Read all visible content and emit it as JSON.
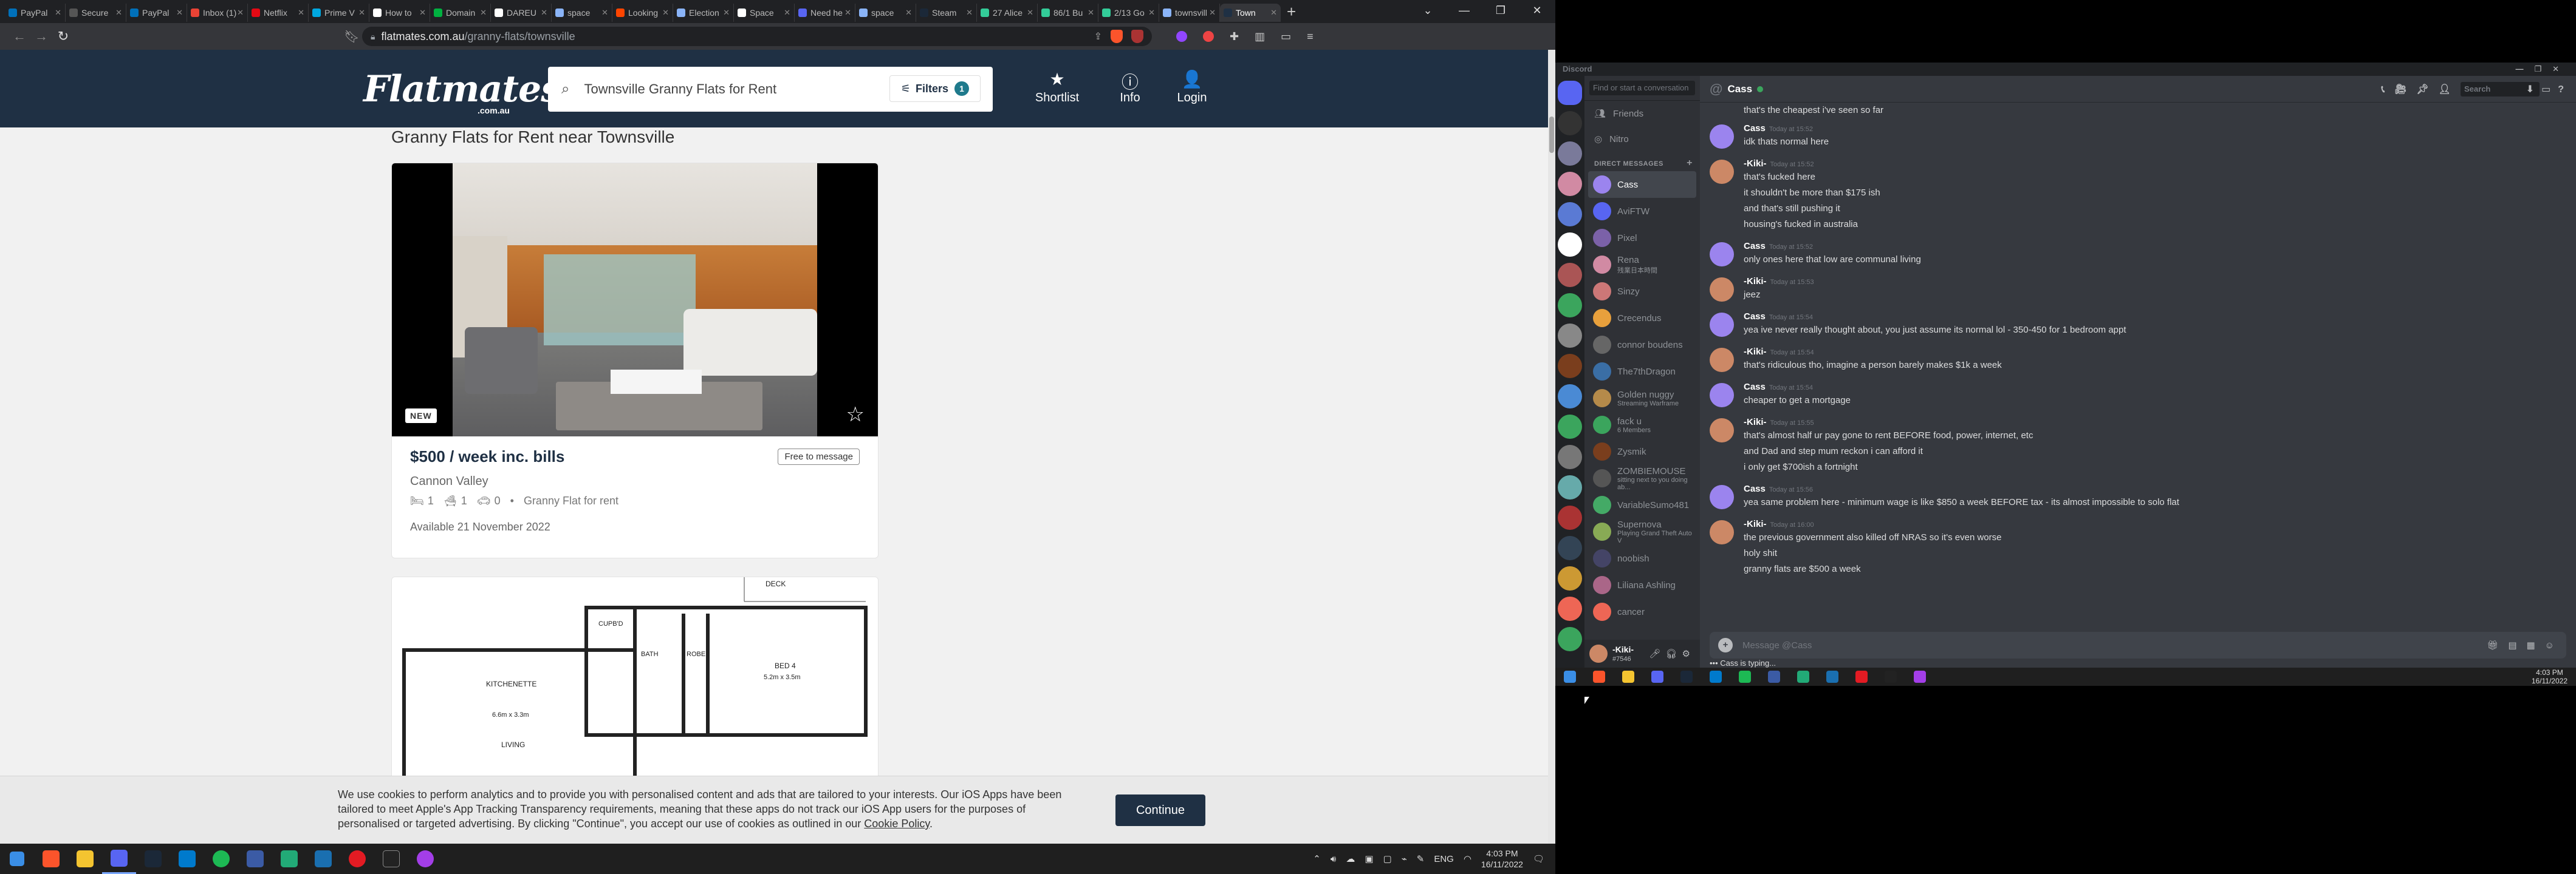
{
  "browser": {
    "tabs": [
      {
        "label": "PayPal",
        "color": "#0070ba"
      },
      {
        "label": "Secure",
        "color": "#555"
      },
      {
        "label": "PayPal",
        "color": "#0070ba"
      },
      {
        "label": "Inbox (1)",
        "color": "#ea4335"
      },
      {
        "label": "Netflix",
        "color": "#e50914"
      },
      {
        "label": "Prime V",
        "color": "#00a8e1"
      },
      {
        "label": "How to",
        "color": "#fff"
      },
      {
        "label": "Domain",
        "color": "#00b140"
      },
      {
        "label": "DAREU",
        "color": "#fff"
      },
      {
        "label": "space",
        "color": "#8ab4f8"
      },
      {
        "label": "Looking",
        "color": "#ff4500"
      },
      {
        "label": "Election",
        "color": "#8ab4f8"
      },
      {
        "label": "Space",
        "color": "#fff"
      },
      {
        "label": "Need he",
        "color": "#5865f2"
      },
      {
        "label": "space",
        "color": "#8ab4f8"
      },
      {
        "label": "Steam",
        "color": "#1b2838"
      },
      {
        "label": "27 Alice",
        "color": "#3c9"
      },
      {
        "label": "86/1 Bu",
        "color": "#3c9"
      },
      {
        "label": "2/13 Go",
        "color": "#3c9"
      },
      {
        "label": "townsvill",
        "color": "#8ab4f8"
      },
      {
        "label": "Town",
        "color": "#1f3044"
      }
    ],
    "active_tab_index": 20,
    "url_host": "flatmates.com.au",
    "url_path": "/granny-flats/townsville"
  },
  "flatmates": {
    "logo": "Flatmates",
    "logo_sub": ".com.au",
    "search_text": "Townsville Granny Flats for Rent",
    "filters_label": "Filters",
    "filters_count": "1",
    "nav": [
      {
        "label": "Shortlist",
        "icon": "★"
      },
      {
        "label": "Info",
        "icon": "ⓘ"
      },
      {
        "label": "Login",
        "icon": "👤"
      }
    ],
    "page_heading": "Granny Flats for Rent near Townsville",
    "listing": {
      "badge": "NEW",
      "price": "$500 / week inc. bills",
      "message_tag": "Free to message",
      "suburb": "Cannon Valley",
      "beds": "1",
      "baths": "1",
      "parking": "0",
      "type": "Granny Flat for rent",
      "available": "Available 21 November 2022"
    },
    "floorplan_labels": {
      "deck": "DECK",
      "cupb": "CUPB'D",
      "bath": "BATH",
      "robe": "ROBE",
      "bed": "BED 4",
      "bed_size": "5.2m x 3.5m",
      "kitchenette": "KITCHENETTE",
      "kitchen_size": "6.6m x 3.3m",
      "living": "LIVING"
    },
    "cookie": {
      "text": "We use cookies to perform analytics and to provide you with personalised content and ads that are tailored to your interests. Our iOS Apps have been tailored to meet Apple's App Tracking Transparency requirements, meaning that these apps do not track our iOS App users for the purposes of personalised or targeted advertising. By clicking \"Continue\", you accept our use of cookies as outlined in our",
      "link": "Cookie Policy",
      "button": "Continue"
    }
  },
  "taskbar": {
    "lang": "ENG",
    "time": "4:03 PM",
    "date": "16/11/2022"
  },
  "discord": {
    "app_title": "Discord",
    "find_placeholder": "Find or start a conversation",
    "nav": [
      "Friends",
      "Nitro"
    ],
    "dm_header": "DIRECT MESSAGES",
    "dms": [
      {
        "name": "Cass",
        "sub": "",
        "color": "#9b84ee"
      },
      {
        "name": "AviFTW",
        "sub": "",
        "color": "#5865f2"
      },
      {
        "name": "Pixel",
        "sub": "",
        "color": "#7b61a8"
      },
      {
        "name": "Rena",
        "sub": "残業日本時間",
        "color": "#d18aa3"
      },
      {
        "name": "Sinzy",
        "sub": "",
        "color": "#c77"
      },
      {
        "name": "Crecendus",
        "sub": "",
        "color": "#e8a03c"
      },
      {
        "name": "connor boudens",
        "sub": "",
        "color": "#666"
      },
      {
        "name": "The7thDragon",
        "sub": "",
        "color": "#3a6ea5"
      },
      {
        "name": "Golden nuggy",
        "sub": "Streaming Warframe",
        "color": "#b58a4a"
      },
      {
        "name": "fack u",
        "sub": "6 Members",
        "color": "#3ba55d"
      },
      {
        "name": "Zysmik",
        "sub": "",
        "color": "#7a3e1d"
      },
      {
        "name": "ZOMBIEMOUSE",
        "sub": "sitting next to you doing ab...",
        "color": "#555"
      },
      {
        "name": "VariableSumo481",
        "sub": "",
        "color": "#4a6"
      },
      {
        "name": "Supernova",
        "sub": "Playing Grand Theft Auto V",
        "color": "#8a5"
      },
      {
        "name": "noobish",
        "sub": "",
        "color": "#446"
      },
      {
        "name": "Liliana Ashling",
        "sub": "",
        "color": "#a68"
      },
      {
        "name": "cancer",
        "sub": "",
        "color": "#e65"
      }
    ],
    "me": {
      "name": "-Kiki-",
      "tag": "#7546"
    },
    "chat_name": "Cass",
    "search_placeholder": "Search",
    "messages": [
      {
        "cont": "that's the cheapest i've seen so far"
      },
      {
        "author": "Cass",
        "time": "Today at 15:52",
        "lines": [
          "idk thats normal here"
        ],
        "color": "#9b84ee"
      },
      {
        "author": "-Kiki-",
        "time": "Today at 15:52",
        "lines": [
          "that's fucked here",
          "it shouldn't be more than $175 ish",
          "and that's still pushing it",
          "housing's fucked in australia"
        ],
        "color": "#c86"
      },
      {
        "author": "Cass",
        "time": "Today at 15:52",
        "lines": [
          "only ones here that low are communal living"
        ],
        "color": "#9b84ee"
      },
      {
        "author": "-Kiki-",
        "time": "Today at 15:53",
        "lines": [
          "jeez"
        ],
        "color": "#c86"
      },
      {
        "author": "Cass",
        "time": "Today at 15:54",
        "lines": [
          "yea ive never really thought about, you just assume its normal lol - 350-450 for 1 bedroom appt"
        ],
        "color": "#9b84ee"
      },
      {
        "author": "-Kiki-",
        "time": "Today at 15:54",
        "lines": [
          "that's ridiculous tho, imagine a person barely makes $1k a week"
        ],
        "color": "#c86"
      },
      {
        "author": "Cass",
        "time": "Today at 15:54",
        "lines": [
          "cheaper to get a mortgage"
        ],
        "color": "#9b84ee"
      },
      {
        "author": "-Kiki-",
        "time": "Today at 15:55",
        "lines": [
          "that's almost half ur pay gone to rent BEFORE food, power, internet, etc",
          "and Dad and step mum reckon i can afford it",
          "i only get $700ish a fortnight"
        ],
        "color": "#c86"
      },
      {
        "author": "Cass",
        "time": "Today at 15:56",
        "lines": [
          "yea same problem here - minimum wage is like $850 a week BEFORE tax - its almost impossible to solo flat"
        ],
        "color": "#9b84ee"
      },
      {
        "author": "-Kiki-",
        "time": "Today at 16:00",
        "lines": [
          "the previous government also killed off NRAS so it's even worse",
          "holy shit",
          "granny flats are $500 a week"
        ],
        "color": "#c86"
      }
    ],
    "input_placeholder": "Message @Cass",
    "typing": "Cass is typing...",
    "time": "4:03 PM",
    "date": "16/11/2022"
  }
}
